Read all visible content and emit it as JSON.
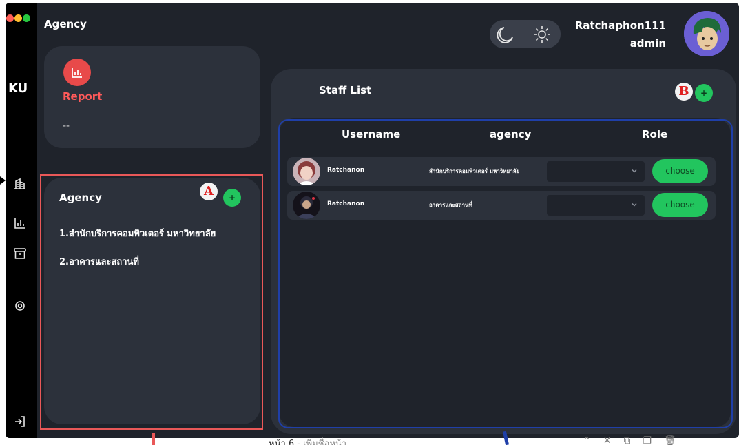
{
  "window": {
    "title": "Agency",
    "brand": "KU"
  },
  "sidebar": {
    "icons": [
      "building-icon",
      "chart-icon",
      "archive-icon",
      "gear-icon",
      "logout-icon"
    ]
  },
  "header": {
    "theme_icons": [
      "moon-icon",
      "sun-icon"
    ],
    "user_name": "Ratchaphon111",
    "user_role": "admin"
  },
  "report": {
    "label": "Report",
    "value": "--"
  },
  "agency": {
    "title": "Agency",
    "add_label": "+",
    "items": [
      "1.สำนักบริการคอมพิวเตอร์ มหาวิทยาลัย",
      "2.อาคารและสถานที่"
    ]
  },
  "staff": {
    "title": "Staff List",
    "add_label": "+",
    "columns": [
      "Username",
      "agency",
      "Role"
    ],
    "rows": [
      {
        "username": "Ratchanon",
        "agency": "สำนักบริการคอมพิวเตอร์ มหาวิทยาลัย",
        "role": "",
        "action": "choose"
      },
      {
        "username": "Ratchanon",
        "agency": "อาคารและสถานที่",
        "role": "",
        "action": "choose"
      }
    ]
  },
  "annotations": {
    "a": "A",
    "b": "B"
  },
  "footer": {
    "page": "หน้า 6",
    "separator": " - ",
    "add_page": "เพิ่มชื่อหน้า"
  },
  "colors": {
    "accent_green": "#22c55e",
    "report_red": "#e84a4a",
    "panel": "#2c313b",
    "background": "#1f232b"
  }
}
